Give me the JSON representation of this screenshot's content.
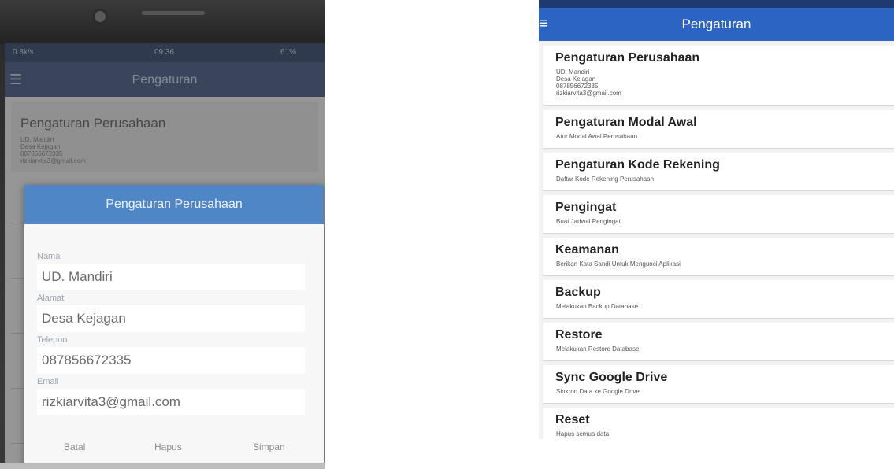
{
  "left_photo": {
    "status_bar": {
      "left": "0.8k/s",
      "time": "09.36",
      "right": "61%"
    },
    "app_title": "Pengaturan",
    "card": {
      "title": "Pengaturan Perusahaan",
      "lines": [
        "UD. Mandiri",
        "Desa Kejagan",
        "087856672335",
        "rizkiarvita3@gmail.com"
      ]
    },
    "dialog": {
      "title": "Pengaturan Perusahaan",
      "fields": [
        {
          "label": "Nama",
          "value": "UD. Mandiri"
        },
        {
          "label": "Alamat",
          "value": "Desa Kejagan"
        },
        {
          "label": "Telepon",
          "value": "087856672335"
        },
        {
          "label": "Email",
          "value": "rizkiarvita3@gmail.com"
        }
      ],
      "buttons": {
        "cancel": "Batal",
        "delete": "Hapus",
        "save": "Simpan"
      }
    }
  },
  "right_screen": {
    "app_title": "Pengaturan",
    "items": [
      {
        "title": "Pengaturan Perusahaan",
        "sub": [
          "UD. Mandiri",
          "Desa Kejagan",
          "087856672335",
          "rizkiarvita3@gmail.com"
        ]
      },
      {
        "title": "Pengaturan Modal Awal",
        "sub": [
          "Atur Modal Awal Perusahaan"
        ]
      },
      {
        "title": "Pengaturan Kode Rekening",
        "sub": [
          "Daftar Kode Rekening Perusahaan"
        ]
      },
      {
        "title": "Pengingat",
        "sub": [
          "Buat Jadwal Pengingat"
        ]
      },
      {
        "title": "Keamanan",
        "sub": [
          "Berikan Kata Sandi Untuk Mengunci Aplikasi"
        ]
      },
      {
        "title": "Backup",
        "sub": [
          "Melakukan Backup Database"
        ]
      },
      {
        "title": "Restore",
        "sub": [
          "Melakukan Restore Database"
        ]
      },
      {
        "title": "Sync Google Drive",
        "sub": [
          "Sinkron Data ke Google Drive"
        ]
      },
      {
        "title": "Reset",
        "sub": [
          "Hapus semua data"
        ]
      }
    ]
  },
  "colors": {
    "appbar": "#2b64c3",
    "dialog_header": "#4f86c6"
  }
}
